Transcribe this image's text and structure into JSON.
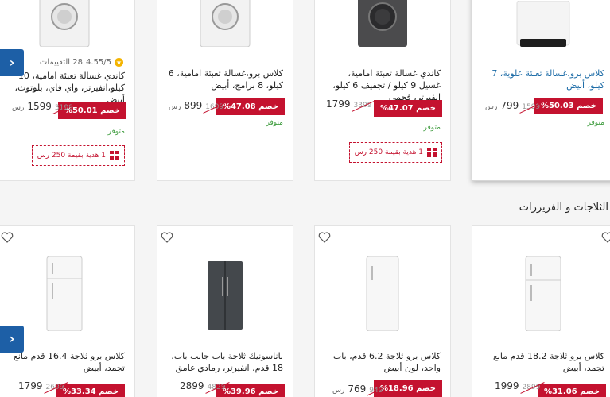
{
  "colors": {
    "accent": "#c4122f",
    "nav": "#1d5fa6",
    "available": "#3a9a3a",
    "link": "#1a6aa6"
  },
  "washers": [
    {
      "title": "كلاس برو،غسالة تعبئة علوية، 7 كيلو، أبيض",
      "discount": "%50.03 خصم",
      "price": "799",
      "old_price": "1599",
      "currency": "رس",
      "availability": "متوفر"
    },
    {
      "title": "كاندي غسالة تعبئة امامية، غسيل 9 كيلو / تجفيف 6 كيلو، انفيرتر، فحمي",
      "discount": "%47.07 خصم",
      "price": "1799",
      "old_price": "3399",
      "currency": "رس",
      "availability": "متوفر",
      "gift": "1 هدية بقيمة 250 رس"
    },
    {
      "title": "كلاس برو،غسالة تعبئة امامية، 6 كيلو، 8 برامج، أبيض",
      "discount": "%47.08 خصم",
      "price": "899",
      "old_price": "1699",
      "currency": "رس",
      "availability": "متوفر"
    },
    {
      "title": "كاندي غسالة تعبئة امامية، 10 كيلو،انفيرتر، واي فاي، بلوتوث، أبيض",
      "rating": "4.55/5",
      "reviews": "28 التقييمات",
      "discount": "%50.01 خصم",
      "price": "1599",
      "old_price": "3199",
      "currency": "رس",
      "availability": "متوفر",
      "gift": "1 هدية بقيمة 250 رس"
    }
  ],
  "fridges_section": {
    "title": "الثلاجات و الفريزرات"
  },
  "fridges": [
    {
      "title": "كلاس برو ثلاجة 18.2 قدم مانع تجمد، أبيض",
      "discount": "%31.06 خصم",
      "price": "1999",
      "old_price": "2899",
      "currency": "رس"
    },
    {
      "title": "كلاس برو ثلاجة 6.2 قدم، باب واحد، لون أبيض",
      "discount": "%18.96 خصم",
      "price": "769",
      "old_price": "949",
      "currency": "رس"
    },
    {
      "title": "باناسونيك ثلاجة باب جانب باب، 18 قدم، انفيرتر، رمادي غامق",
      "discount": "%39.96 خصم",
      "price": "2899",
      "old_price": "4829",
      "currency": "رس"
    },
    {
      "title": "كلاس برو ثلاجة 16.4 قدم مانع تجمد، أبيض",
      "discount": "%33.34 خصم",
      "price": "1799",
      "old_price": "2699",
      "currency": "رس"
    }
  ],
  "nav": {
    "prev_icon": "chevron-left-icon",
    "label": "‹"
  }
}
